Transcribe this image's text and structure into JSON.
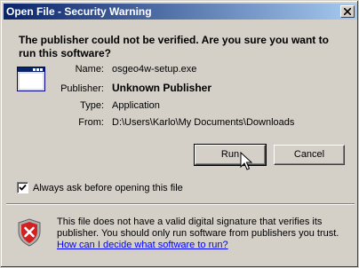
{
  "window": {
    "title": "Open File - Security Warning"
  },
  "dialog": {
    "heading": "The publisher could not be verified.  Are you sure you want to run this software?",
    "fields": {
      "name_label": "Name:",
      "name_value": "osgeo4w-setup.exe",
      "publisher_label": "Publisher:",
      "publisher_value": "Unknown Publisher",
      "type_label": "Type:",
      "type_value": "Application",
      "from_label": "From:",
      "from_value": "D:\\Users\\Karlo\\My Documents\\Downloads"
    },
    "buttons": {
      "run_label": "Run",
      "cancel_label": "Cancel"
    },
    "checkbox": {
      "label": "Always ask before opening this file",
      "checked": true
    }
  },
  "warning": {
    "text": "This file does not have a valid digital signature that verifies its publisher.  You should only run software from publishers you trust.",
    "link_text": "How can I decide what software to run?"
  },
  "colors": {
    "titlebar_start": "#0a246a",
    "titlebar_end": "#a6caf0",
    "dialog_bg": "#d4d0c8",
    "link": "#0000ff",
    "shield_red": "#d32020"
  },
  "icons": {
    "app": "application-window-icon",
    "shield": "security-shield-icon",
    "close": "close-icon",
    "cursor": "mouse-pointer-icon"
  }
}
